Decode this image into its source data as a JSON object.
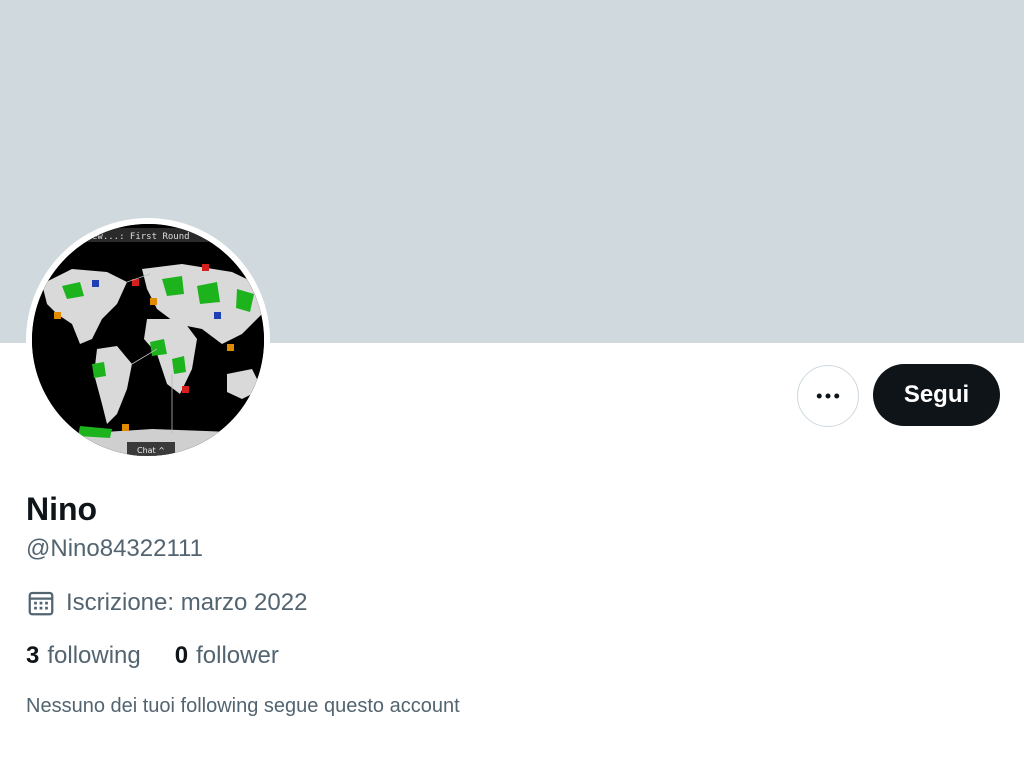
{
  "profile": {
    "display_name": "Nino",
    "handle": "@Nino84322111",
    "joined": "Iscrizione: marzo 2022",
    "mutuals_note": "Nessuno dei tuoi following segue questo account"
  },
  "stats": {
    "following_count": "3",
    "following_label": "following",
    "followers_count": "0",
    "followers_label": "follower"
  },
  "actions": {
    "follow_label": "Segui",
    "more_icon": "more-horizontal-icon"
  },
  "avatar": {
    "top_text": "ew...: First Round",
    "bottom_text": "Chat ^"
  },
  "colors": {
    "banner": "#cfd9de",
    "primary_text": "#0f1419",
    "secondary_text": "#536471",
    "follow_button_bg": "#0f1419"
  }
}
